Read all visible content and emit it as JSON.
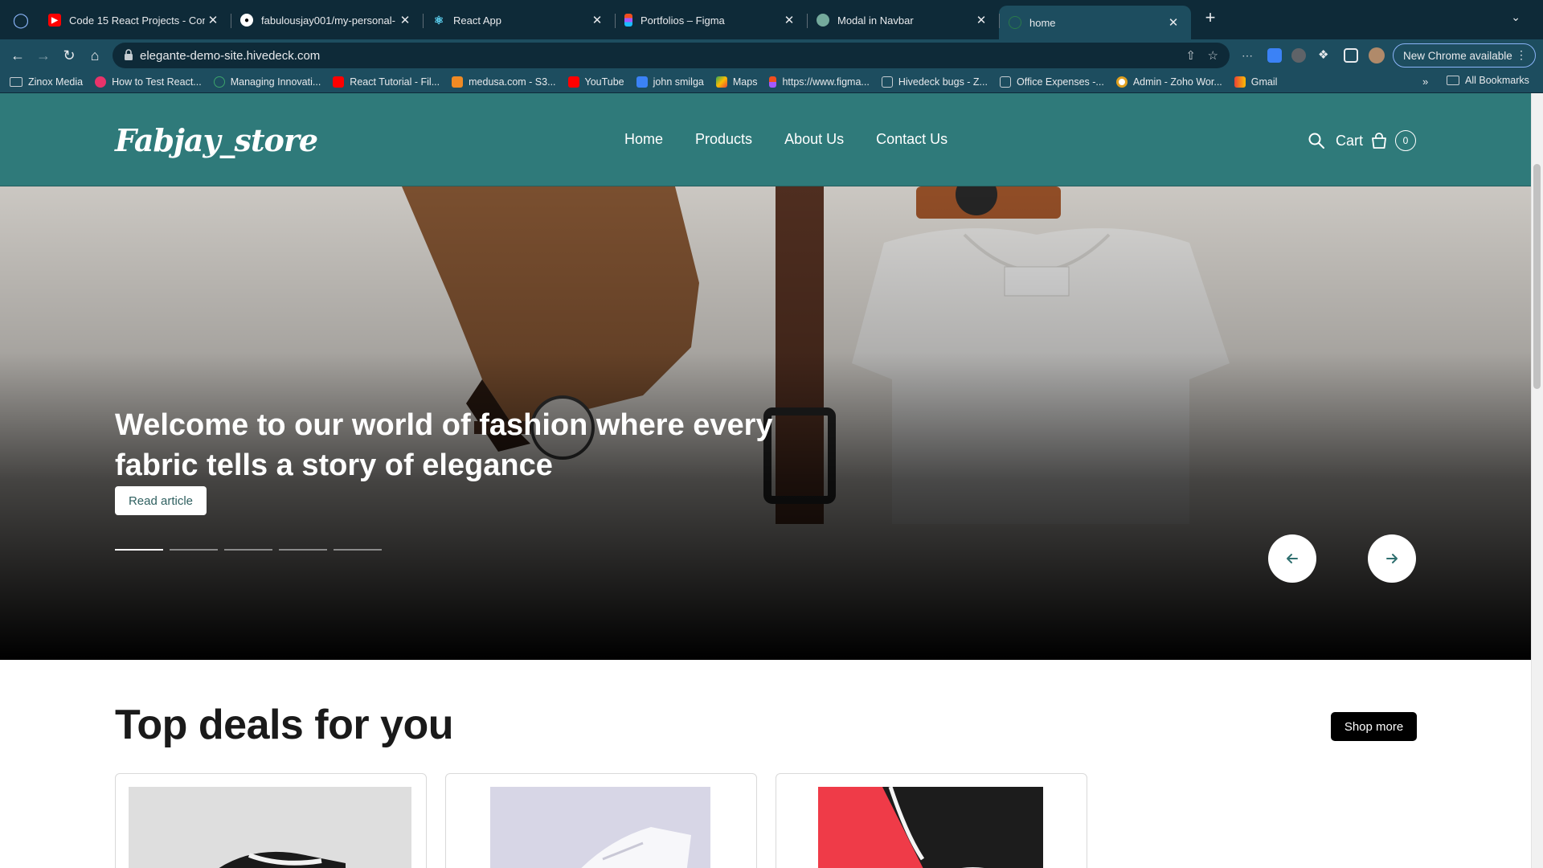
{
  "browser": {
    "tabs": [
      {
        "title": "Code 15 React Projects - Com",
        "favicon": "youtube-icon",
        "active": false
      },
      {
        "title": "fabulousjay001/my-personal-",
        "favicon": "github-icon",
        "active": false
      },
      {
        "title": "React App",
        "favicon": "react-icon",
        "active": false
      },
      {
        "title": "Portfolios – Figma",
        "favicon": "figma-icon",
        "active": false
      },
      {
        "title": "Modal in Navbar",
        "favicon": "chatgpt-icon",
        "active": false
      },
      {
        "title": "home",
        "favicon": "globe-icon",
        "active": true
      }
    ],
    "url": "elegante-demo-site.hivedeck.com",
    "update_button": "New Chrome available",
    "bookmarks": [
      {
        "label": "Zinox Media",
        "icon": "folder-icon"
      },
      {
        "label": "How to Test React...",
        "icon": "pink-circle-icon"
      },
      {
        "label": "Managing Innovati...",
        "icon": "green-check-icon"
      },
      {
        "label": "React Tutorial - Fil...",
        "icon": "youtube-icon"
      },
      {
        "label": "medusa.com - S3...",
        "icon": "medusa-cube-icon"
      },
      {
        "label": "YouTube",
        "icon": "youtube-icon"
      },
      {
        "label": "john smilga",
        "icon": "r-logo-icon"
      },
      {
        "label": "Maps",
        "icon": "maps-icon"
      },
      {
        "label": "https://www.figma...",
        "icon": "figma-icon"
      },
      {
        "label": "Hivedeck bugs - Z...",
        "icon": "doc-icon"
      },
      {
        "label": "Office Expenses -...",
        "icon": "doc-icon"
      },
      {
        "label": "Admin - Zoho Wor...",
        "icon": "zoho-icon"
      },
      {
        "label": "Gmail",
        "icon": "gmail-icon"
      }
    ],
    "bookmarks_more": "»",
    "all_bookmarks": "All Bookmarks"
  },
  "site": {
    "logo": "Fabjay_store",
    "nav": [
      "Home",
      "Products",
      "About Us",
      "Contact Us"
    ],
    "cart_label": "Cart",
    "cart_count": "0",
    "hero": {
      "title": "Welcome to our world of fashion where every fabric tells a story of elegance",
      "button": "Read article",
      "slide_count": 5,
      "active_slide": 1
    },
    "deals": {
      "title": "Top deals for you",
      "button": "Shop more"
    }
  },
  "colors": {
    "header_teal": "#2f7a7a",
    "chrome_dark": "#0e2a38",
    "chrome_toolbar": "#1d4d5f"
  }
}
